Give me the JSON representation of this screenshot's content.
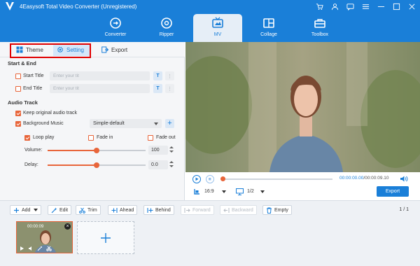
{
  "app": {
    "title": "4Easysoft Total Video Converter (Unregistered)"
  },
  "nav": {
    "tabs": [
      {
        "label": "Converter",
        "icon": "converter-icon"
      },
      {
        "label": "Ripper",
        "icon": "ripper-icon"
      },
      {
        "label": "MV",
        "icon": "mv-icon",
        "active": true
      },
      {
        "label": "Collage",
        "icon": "collage-icon"
      },
      {
        "label": "Toolbox",
        "icon": "toolbox-icon"
      }
    ]
  },
  "subtabs": {
    "theme": "Theme",
    "setting": "Setting",
    "export": "Export"
  },
  "start_end": {
    "title": "Start & End",
    "start_label": "Start Title",
    "end_label": "End Title",
    "start_placeholder": "Enter your tit",
    "end_placeholder": "Enter your tit",
    "t_button": "T"
  },
  "audio": {
    "title": "Audio Track",
    "keep_original": "Keep original audio track",
    "background_music": "Background Music",
    "music_selected": "Simple-default",
    "loop_play": "Loop play",
    "fade_in": "Fade in",
    "fade_out": "Fade out",
    "volume_label": "Volume:",
    "volume_value": "100",
    "volume_level": 0.5,
    "delay_label": "Delay:",
    "delay_value": "0.0",
    "delay_level": 0.5
  },
  "preview": {
    "current_time": "00:00:00.00",
    "total_time": "/00:00:09.10",
    "aspect": "16:9",
    "page": "1/2",
    "export_label": "Export"
  },
  "toolbar": {
    "add": "Add",
    "edit": "Edit",
    "trim": "Trim",
    "ahead": "Ahead",
    "behind": "Behind",
    "forward": "Forward",
    "backward": "Backward",
    "empty": "Empty",
    "page_indicator": "1 / 1"
  },
  "timeline": {
    "clip_duration": "00:00:09"
  },
  "colors": {
    "brand": "#1a7fd8",
    "accent": "#e8653a",
    "highlight": "#e00000"
  }
}
